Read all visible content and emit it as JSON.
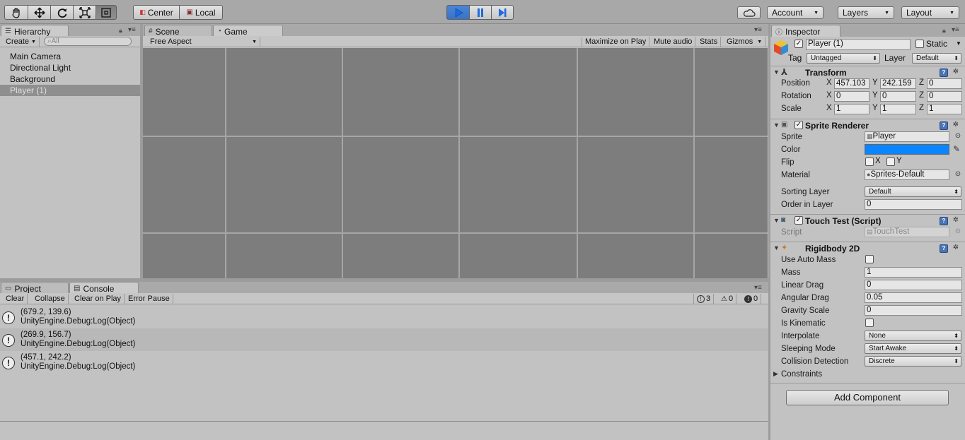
{
  "toolbar": {
    "tools": [
      "hand",
      "move",
      "rotate",
      "scale",
      "rect"
    ],
    "pivot_center": "Center",
    "pivot_local": "Local",
    "account": "Account",
    "layers": "Layers",
    "layout": "Layout"
  },
  "hierarchy": {
    "tab": "Hierarchy",
    "create": "Create",
    "search_placeholder": "All",
    "items": [
      {
        "label": "Main Camera",
        "selected": false
      },
      {
        "label": "Directional Light",
        "selected": false
      },
      {
        "label": "Background",
        "selected": false
      },
      {
        "label": "Player (1)",
        "selected": true
      }
    ]
  },
  "views": {
    "scene_tab": "Scene",
    "game_tab": "Game",
    "aspect": "Free Aspect",
    "maximize": "Maximize on Play",
    "mute": "Mute audio",
    "stats": "Stats",
    "gizmos": "Gizmos"
  },
  "bottom": {
    "project_tab": "Project",
    "console_tab": "Console",
    "clear": "Clear",
    "collapse": "Collapse",
    "clear_on_play": "Clear on Play",
    "error_pause": "Error Pause",
    "count_logs": "3",
    "count_warnings": "0",
    "count_errors": "0",
    "logs": [
      {
        "line1": "(679.2, 139.6)",
        "line2": "UnityEngine.Debug:Log(Object)"
      },
      {
        "line1": "(269.9, 156.7)",
        "line2": "UnityEngine.Debug:Log(Object)"
      },
      {
        "line1": "(457.1, 242.2)",
        "line2": "UnityEngine.Debug:Log(Object)"
      }
    ]
  },
  "inspector": {
    "tab": "Inspector",
    "object_name": "Player (1)",
    "static_label": "Static",
    "tag_label": "Tag",
    "tag_value": "Untagged",
    "layer_label": "Layer",
    "layer_value": "Default",
    "transform": {
      "title": "Transform",
      "position_label": "Position",
      "rotation_label": "Rotation",
      "scale_label": "Scale",
      "position": {
        "x": "457.103",
        "y": "242.159",
        "z": "0"
      },
      "rotation": {
        "x": "0",
        "y": "0",
        "z": "0"
      },
      "scale": {
        "x": "1",
        "y": "1",
        "z": "1"
      }
    },
    "sprite_renderer": {
      "title": "Sprite Renderer",
      "sprite_label": "Sprite",
      "sprite_value": "Player",
      "color_label": "Color",
      "color_value": "#0a84ff",
      "flip_label": "Flip",
      "flip_x": "X",
      "flip_y": "Y",
      "material_label": "Material",
      "material_value": "Sprites-Default",
      "sorting_layer_label": "Sorting Layer",
      "sorting_layer_value": "Default",
      "order_label": "Order in Layer",
      "order_value": "0"
    },
    "touch_test": {
      "title": "Touch Test (Script)",
      "script_label": "Script",
      "script_value": "TouchTest"
    },
    "rigidbody": {
      "title": "Rigidbody 2D",
      "use_auto_mass": "Use Auto Mass",
      "mass_label": "Mass",
      "mass": "1",
      "linear_drag_label": "Linear Drag",
      "linear_drag": "0",
      "angular_drag_label": "Angular Drag",
      "angular_drag": "0.05",
      "gravity_label": "Gravity Scale",
      "gravity": "0",
      "kinematic_label": "Is Kinematic",
      "interpolate_label": "Interpolate",
      "interpolate": "None",
      "sleeping_label": "Sleeping Mode",
      "sleeping": "Start Awake",
      "collision_label": "Collision Detection",
      "collision": "Discrete",
      "constraints_label": "Constraints"
    },
    "add_component": "Add Component"
  }
}
